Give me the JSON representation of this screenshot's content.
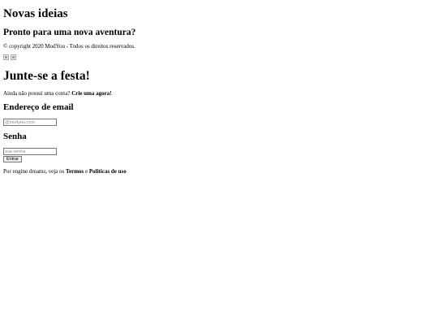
{
  "hero": {
    "title": "Novas ideias",
    "subtitle": "Pronto para uma nova aventura?",
    "copyright": "© copyright 2020 ModYou - Todos os direitos reservados."
  },
  "badges": [
    {
      "icon": "broken-image-icon"
    },
    {
      "icon": "broken-image-icon"
    }
  ],
  "login": {
    "title": "Junte-se a festa!",
    "signup_prompt": "Ainda não possui uma conta? ",
    "signup_link": "Crie uma agora!",
    "email_label": "Endereço de email",
    "email_placeholder": "@modyou.com",
    "password_label": "Senha",
    "password_placeholder": "sua senha",
    "submit_label": "Entrar",
    "terms_prefix": "Por engine dreams, veja os ",
    "terms_link": "Termos",
    "terms_mid": " e ",
    "privacy_link": "Politicas de uso"
  }
}
